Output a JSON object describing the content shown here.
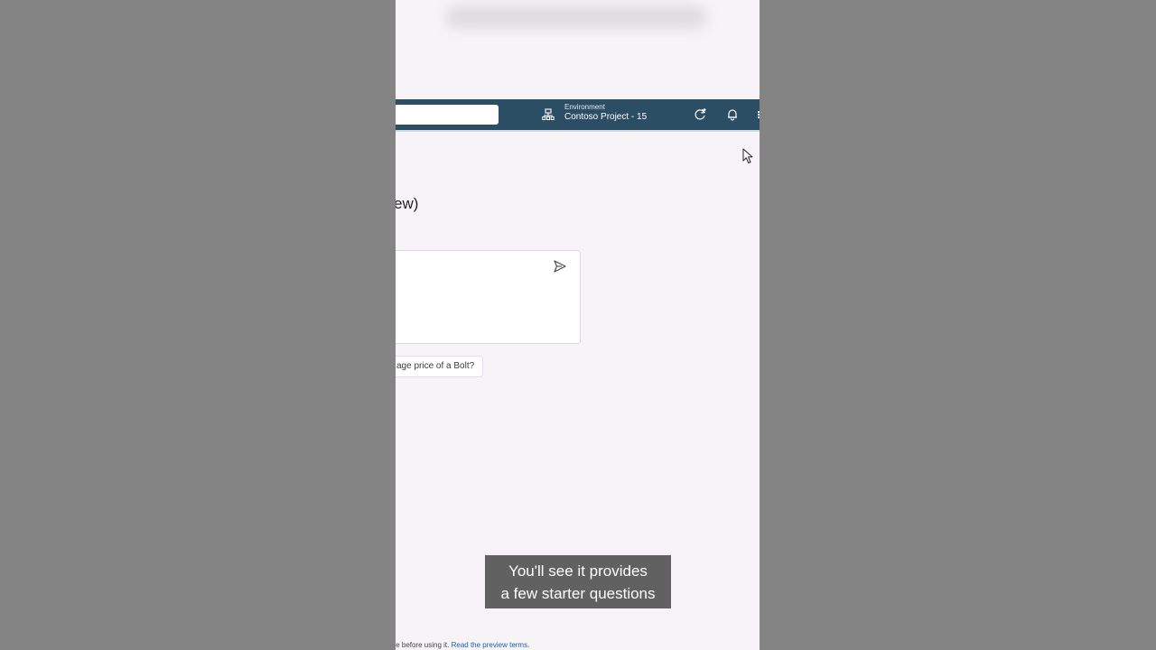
{
  "topbar": {
    "environment_label": "Environment",
    "environment_value": "Contoso Project - 15",
    "search_placeholder": ""
  },
  "main": {
    "heading_fragment": "ew)",
    "chat_input_placeholder": "",
    "starter_question": "age price of a Bolt?"
  },
  "footer": {
    "note_fragment": "te before using it.",
    "link_text": "Read the preview terms."
  },
  "caption": {
    "line1": "You'll see it provides",
    "line2": "a few starter questions"
  },
  "icons": {
    "environment": "globe-network-icon",
    "refresh": "refresh-sync-icon",
    "notifications": "bell-icon",
    "send": "send-icon",
    "cursor": "mouse-pointer-icon"
  },
  "colors": {
    "header_bar": "#2c4e64",
    "page_background": "#f6f4f7",
    "letterbox": "#848484",
    "link": "#1b5fa8"
  }
}
